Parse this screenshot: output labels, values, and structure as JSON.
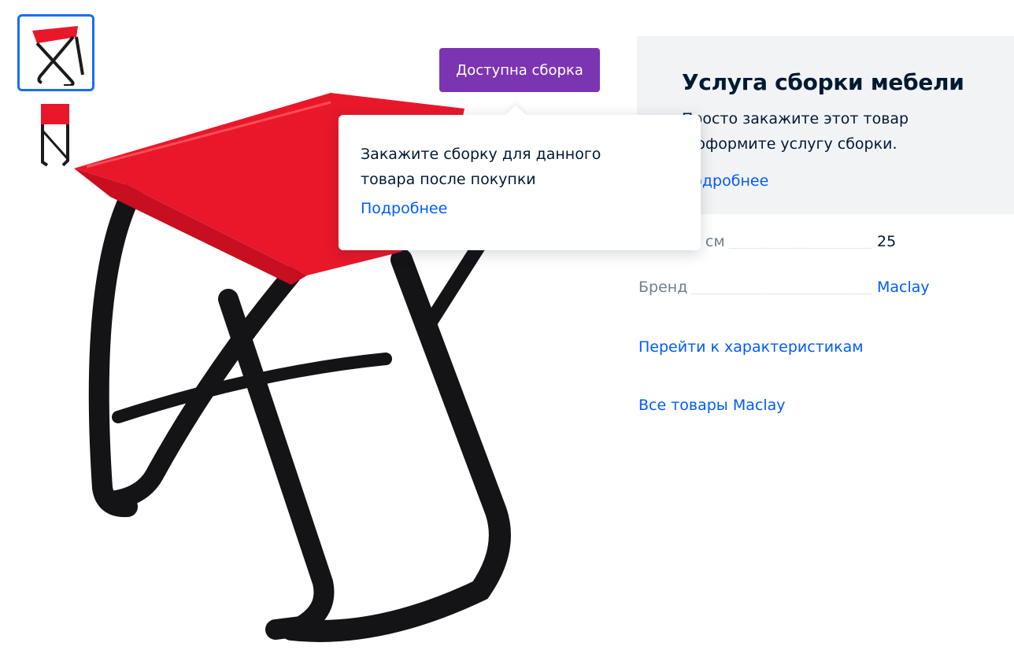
{
  "gallery": {
    "thumbnails": [
      {
        "name": "thumb-front",
        "selected": true
      },
      {
        "name": "thumb-side",
        "selected": false
      }
    ],
    "accent_color": "#1a6ef0"
  },
  "badge": {
    "label": "Доступна сборка",
    "color": "#7b35b2"
  },
  "tooltip": {
    "text": "Закажите сборку для данного товара после покупки",
    "link": "Подробнее"
  },
  "service": {
    "title": "Услуга сборки мебели",
    "text": "Просто закажите этот товар\nи оформите услугу сборки.",
    "link": "Подробнее",
    "background": "#f2f3f5"
  },
  "specs": [
    {
      "label": "Высота, см",
      "value": "25",
      "is_link": false
    },
    {
      "label": "Бренд",
      "value": "Maclay",
      "is_link": true
    }
  ],
  "links": {
    "characteristics": "Перейти к характеристикам",
    "all_products": "Все товары Maclay"
  },
  "colors": {
    "link": "#005bff",
    "text": "#001a34",
    "muted": "#707f8d"
  }
}
